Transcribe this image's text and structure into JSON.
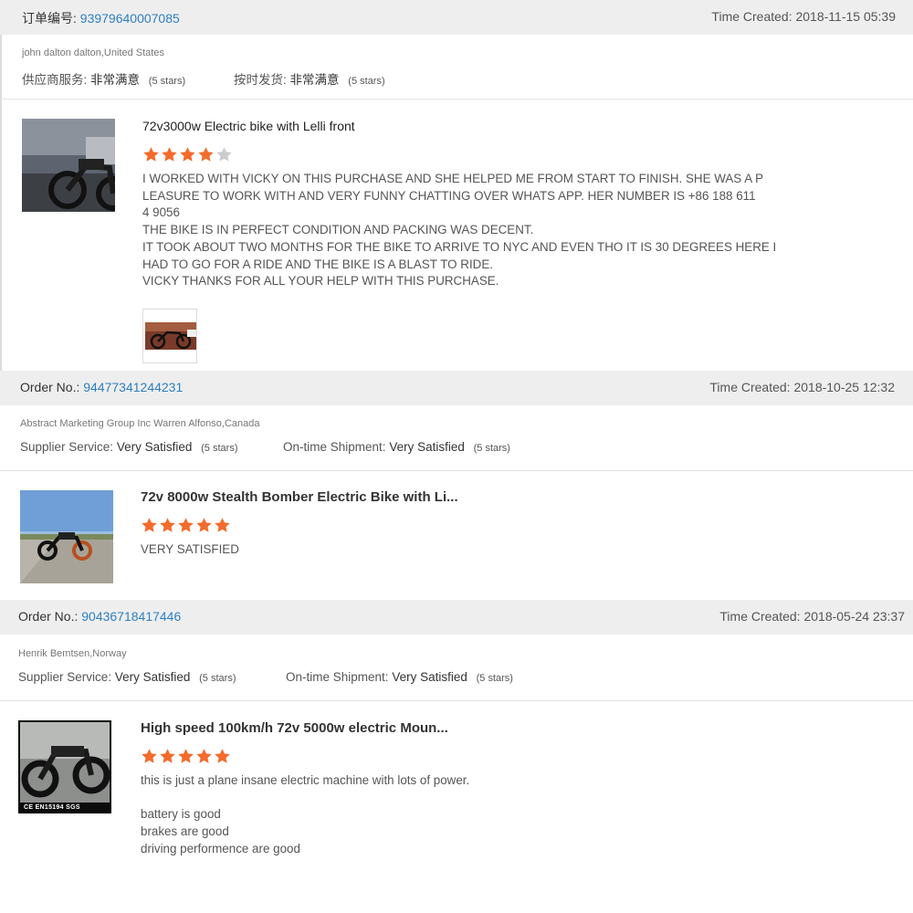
{
  "colors": {
    "accent": "#2e7fc1",
    "star": "#f46b2b",
    "star_empty": "#cccccc",
    "header_bg": "#eeeeee"
  },
  "reviews": [
    {
      "order_label": "订单编号:",
      "order_no": "93979640007085",
      "time_created": "Time Created: 2018-11-15 05:39",
      "buyer": "john dalton dalton,United States",
      "supplier_label": "供应商服务:",
      "supplier_value": "非常满意",
      "supplier_stars": "(5 stars)",
      "shipment_label": "按时发货:",
      "shipment_value": "非常满意",
      "shipment_stars": "(5 stars)",
      "product_title": "72v3000w Electric bike with Lelli front",
      "rating": 4,
      "comment": "I WORKED WITH VICKY ON THIS PURCHASE AND SHE HELPED ME FROM START TO FINISH. SHE WAS A P\nLEASURE TO WORK WITH AND VERY FUNNY CHATTING OVER WHATS APP. HER NUMBER IS +86 188 611\n4 9056\nTHE BIKE IS IN PERFECT CONDITION AND PACKING WAS DECENT.\nIT TOOK ABOUT TWO MONTHS FOR THE BIKE TO ARRIVE TO NYC AND EVEN THO IT IS 30 DEGREES HERE I\nHAD TO GO FOR A RIDE AND THE BIKE IS A BLAST TO RIDE.\nVICKY THANKS FOR ALL YOUR HELP WITH THIS PURCHASE."
    },
    {
      "order_label": "Order No.:",
      "order_no": "94477341244231",
      "time_created": "Time Created: 2018-10-25 12:32",
      "buyer": "Abstract Marketing Group Inc Warren Alfonso,Canada",
      "supplier_label": "Supplier Service:",
      "supplier_value": "Very Satisfied",
      "supplier_stars": "(5 stars)",
      "shipment_label": "On-time Shipment:",
      "shipment_value": "Very Satisfied",
      "shipment_stars": "(5 stars)",
      "product_title": "72v 8000w Stealth Bomber Electric Bike with Li...",
      "rating": 5,
      "comment": "VERY SATISFIED"
    },
    {
      "order_label": "Order No.:",
      "order_no": "90436718417446",
      "time_created": "Time Created: 2018-05-24 23:37",
      "buyer": "Henrik Bemtsen,Norway",
      "supplier_label": "Supplier Service:",
      "supplier_value": "Very Satisfied",
      "supplier_stars": "(5 stars)",
      "shipment_label": "On-time Shipment:",
      "shipment_value": "Very Satisfied",
      "shipment_stars": "(5 stars)",
      "product_title": "High speed 100km/h 72v 5000w electric Moun...",
      "rating": 5,
      "comment": "this is just a plane insane electric machine with lots of power.\n\nbattery is good\nbrakes are good\ndriving performence are good",
      "thumb_badge": "CE EN15194 SGS"
    }
  ]
}
